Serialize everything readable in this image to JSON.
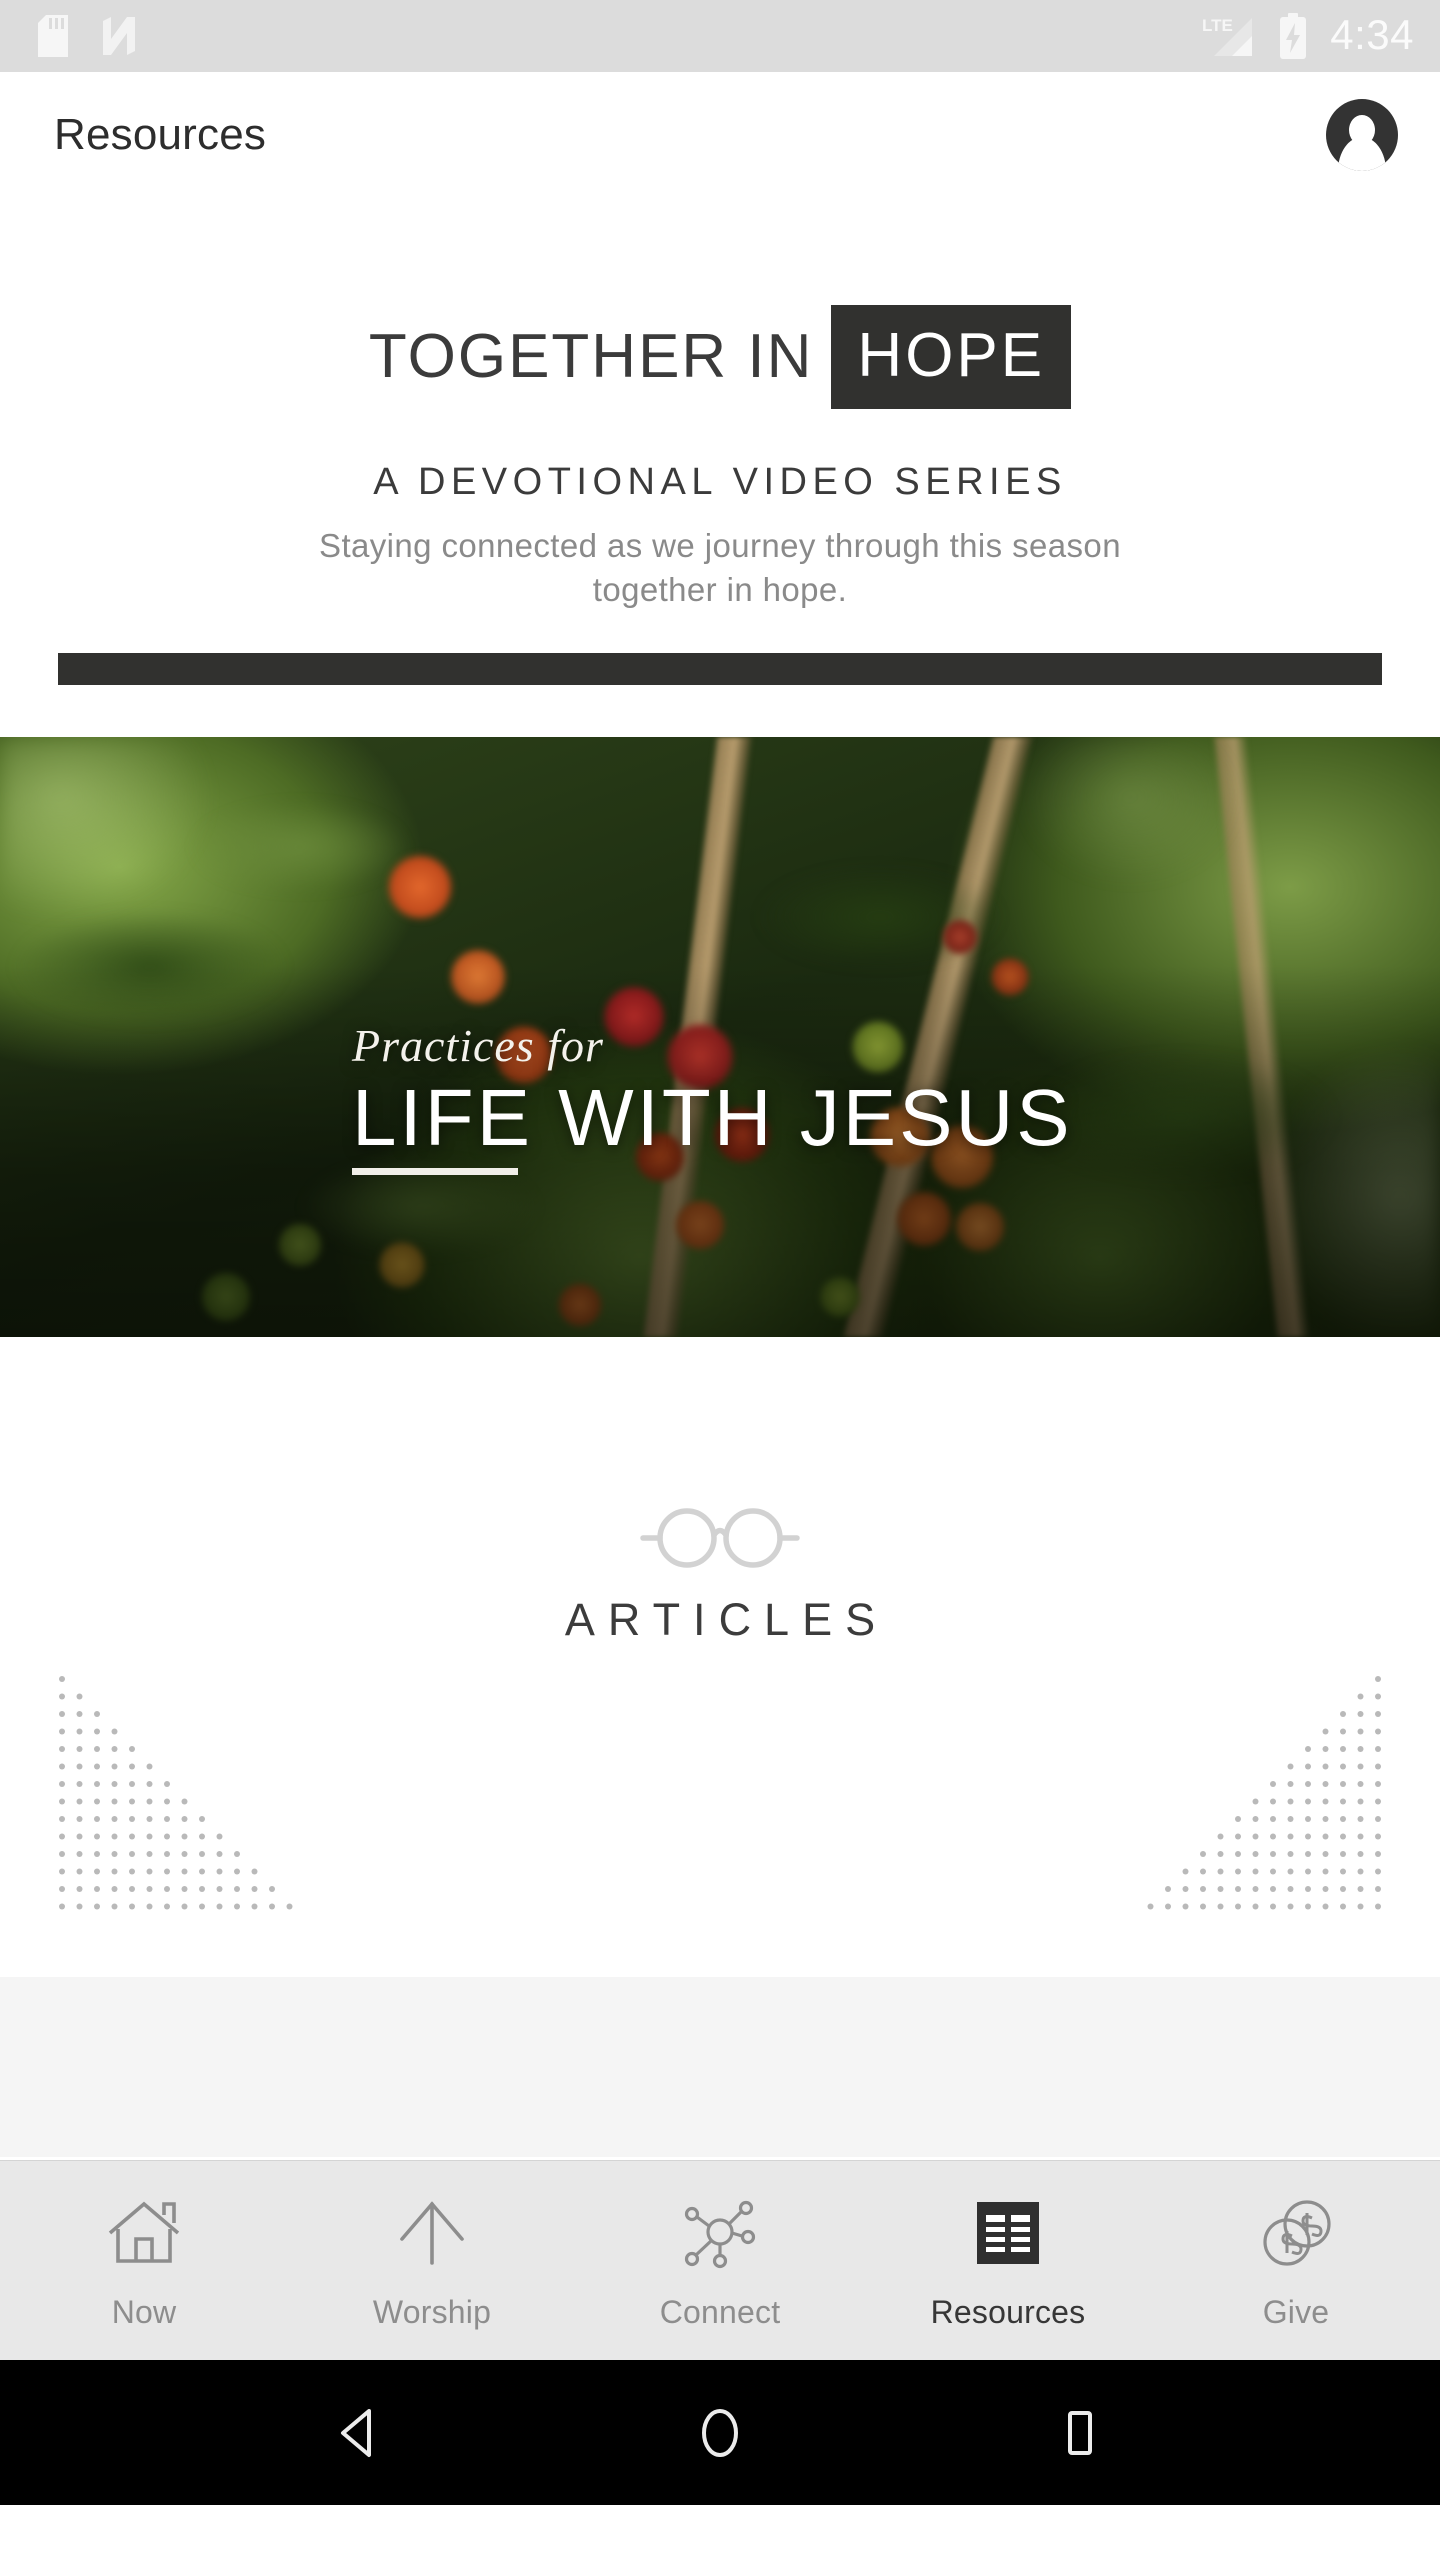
{
  "status_bar": {
    "time": "4:34",
    "network_type": "LTE",
    "icons": [
      "sd-card-icon",
      "android-nougat-icon",
      "lte-signal-icon",
      "battery-charging-icon"
    ]
  },
  "header": {
    "title": "Resources",
    "avatar": "account-avatar-icon"
  },
  "cards": {
    "hope": {
      "title_part1": "TOGETHER IN",
      "title_part2": "HOPE",
      "subtitle": "A DEVOTIONAL VIDEO SERIES",
      "description": "Staying connected as we journey through this season together in hope."
    },
    "life_with_jesus": {
      "pre_title": "Practices for",
      "title": "LIFE WITH JESUS",
      "image": "coffee-cherries-branch-photo"
    },
    "articles": {
      "label": "ARTICLES",
      "icon": "eyeglasses-icon",
      "decoration": "dotted-triangle-pattern"
    }
  },
  "tabs": [
    {
      "label": "Now",
      "icon": "home-icon",
      "active": false
    },
    {
      "label": "Worship",
      "icon": "arrow-up-icon",
      "active": false
    },
    {
      "label": "Connect",
      "icon": "network-icon",
      "active": false
    },
    {
      "label": "Resources",
      "icon": "list-icon",
      "active": true
    },
    {
      "label": "Give",
      "icon": "coins-icon",
      "active": false
    }
  ],
  "android_nav": {
    "back": "back-triangle-icon",
    "home": "home-circle-icon",
    "recents": "recents-square-icon"
  },
  "colors": {
    "status_bar_bg": "#dcdcdc",
    "dark": "#31312f",
    "tab_bar_bg": "#e8e8e8",
    "tab_active_text": "#373737",
    "tab_inactive_text": "#8d8d8d",
    "muted_text": "#8a8a8a",
    "filler_bg": "#f5f5f5"
  }
}
